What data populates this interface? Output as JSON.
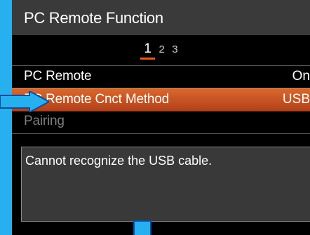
{
  "header": {
    "title": "PC Remote Function"
  },
  "pagination": {
    "pages": [
      "1",
      "2",
      "3"
    ],
    "active": "1"
  },
  "menu": {
    "items": [
      {
        "label": "PC Remote",
        "value": "On"
      },
      {
        "label": "PC Remote Cnct Method",
        "value": "USB"
      },
      {
        "label": "Pairing",
        "value": ""
      }
    ]
  },
  "message": {
    "text": "Cannot recognize the USB cable."
  },
  "colors": {
    "accent": "#e8591c",
    "highlight": "#27b0f0"
  }
}
